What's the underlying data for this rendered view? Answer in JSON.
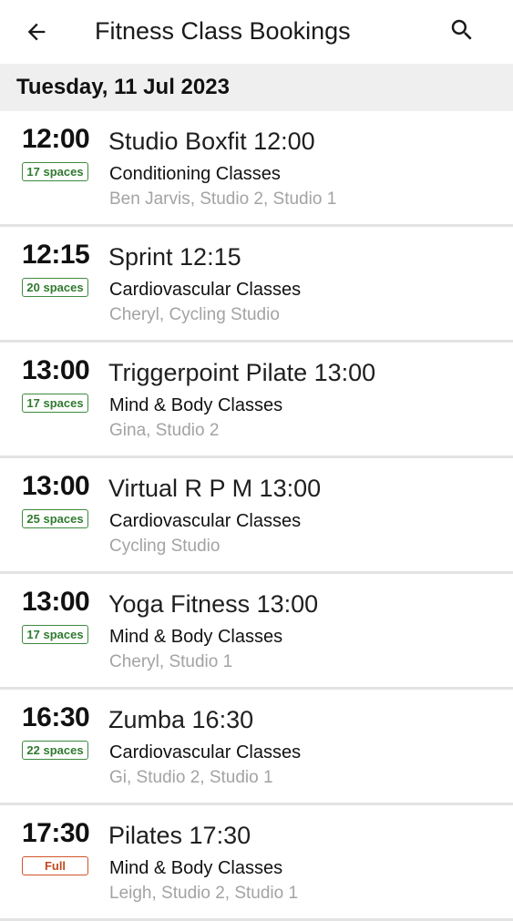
{
  "appbar": {
    "title": "Fitness Class Bookings",
    "back_icon": "arrow-left-icon",
    "search_icon": "search-icon"
  },
  "date_header": "Tuesday, 11 Jul 2023",
  "classes": [
    {
      "time": "12:00",
      "spaces": "17 spaces",
      "full": false,
      "name": "Studio Boxfit 12:00",
      "category": "Conditioning Classes",
      "location": "Ben Jarvis, Studio 2, Studio 1"
    },
    {
      "time": "12:15",
      "spaces": "20 spaces",
      "full": false,
      "name": "Sprint 12:15",
      "category": "Cardiovascular Classes",
      "location": "Cheryl, Cycling Studio"
    },
    {
      "time": "13:00",
      "spaces": "17 spaces",
      "full": false,
      "name": "Triggerpoint Pilate 13:00",
      "category": "Mind & Body Classes",
      "location": "Gina, Studio 2"
    },
    {
      "time": "13:00",
      "spaces": "25 spaces",
      "full": false,
      "name": "Virtual R P M 13:00",
      "category": "Cardiovascular Classes",
      "location": "Cycling Studio"
    },
    {
      "time": "13:00",
      "spaces": "17 spaces",
      "full": false,
      "name": "Yoga Fitness 13:00",
      "category": "Mind & Body Classes",
      "location": "Cheryl, Studio 1"
    },
    {
      "time": "16:30",
      "spaces": "22 spaces",
      "full": false,
      "name": "Zumba 16:30",
      "category": "Cardiovascular Classes",
      "location": "Gi, Studio 2, Studio 1"
    },
    {
      "time": "17:30",
      "spaces": "Full",
      "full": true,
      "name": "Pilates 17:30",
      "category": "Mind & Body Classes",
      "location": "Leigh, Studio 2, Studio 1"
    }
  ],
  "colors": {
    "available_badge": "#3f8a3f",
    "full_badge": "#d0542a",
    "date_header_bg": "#efefef",
    "secondary_text": "#a3a3a3"
  }
}
